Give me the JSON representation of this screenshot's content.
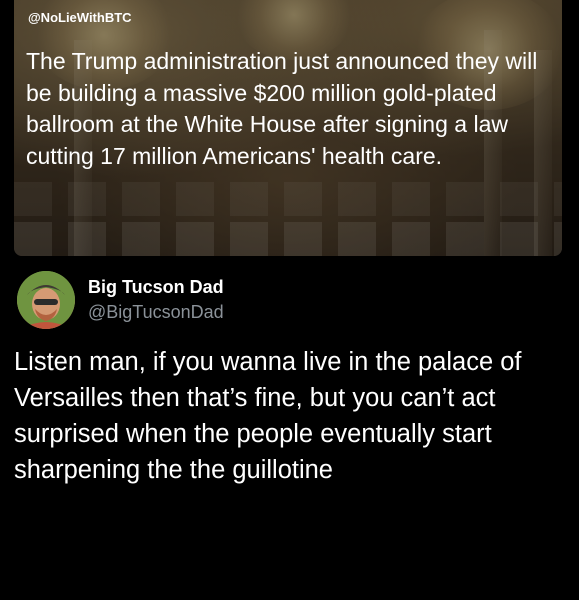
{
  "media_card": {
    "source_handle": "@NoLieWithBTC",
    "caption": "The Trump administration just announced they will be building a massive $200 million gold-plated ballroom at the White House after signing a law cutting 17 million Americans' health care."
  },
  "tweet": {
    "display_name": "Big Tucson Dad",
    "handle": "@BigTucsonDad",
    "text": "Listen man, if you wanna live in the palace of Versailles then that’s fine, but you can’t act surprised when the people eventually start sharpening the the guillotine"
  },
  "colors": {
    "background": "#000000",
    "primary_text": "#ffffff",
    "secondary_text": "#8b9299"
  }
}
